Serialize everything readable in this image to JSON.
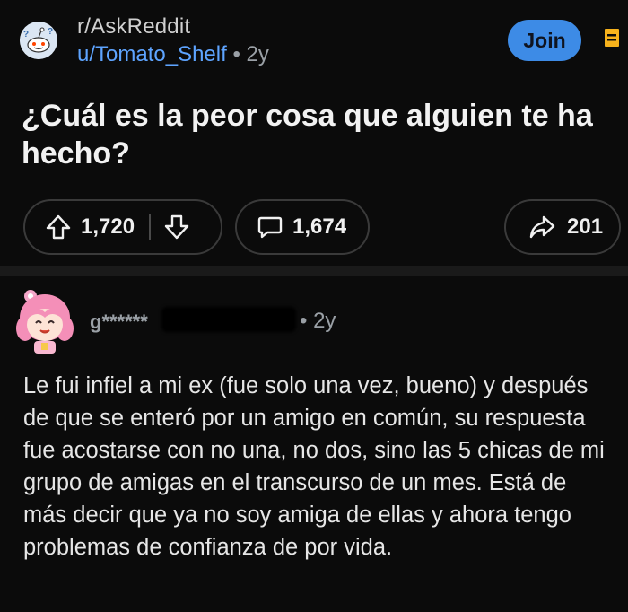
{
  "post": {
    "subreddit": "r/AskReddit",
    "author": "u/Tomato_Shelf",
    "separator": " • ",
    "age": "2y",
    "join_label": "Join",
    "title": "¿Cuál es la peor cosa que alguien te ha hecho?",
    "score": "1,720",
    "comments": "1,674",
    "shares": "201"
  },
  "comment": {
    "author_visible": "g******",
    "separator": "• ",
    "age": "2y",
    "body": "Le fui infiel a mi ex (fue solo una vez, bueno) y después de que se enteró por un amigo en común, su respuesta fue acostarse con no una, no dos, sino las 5 chicas de mi grupo de amigas en el transcurso de un mes. Está de más decir que ya no soy amiga de ellas y ahora tengo problemas de confianza de por vida."
  },
  "icons": {
    "subreddit_avatar": "reddit-alien-icon",
    "bookmark": "bookmark-icon",
    "upvote": "upvote-arrow-icon",
    "downvote": "downvote-arrow-icon",
    "comment": "comment-bubble-icon",
    "share": "share-arrow-icon",
    "commenter_avatar": "pink-hair-avatar-icon"
  },
  "colors": {
    "background": "#0b0b0b",
    "accent_blue": "#3d8be6",
    "username_blue": "#5ea4ff",
    "bookmark_orange": "#f7b21c"
  }
}
